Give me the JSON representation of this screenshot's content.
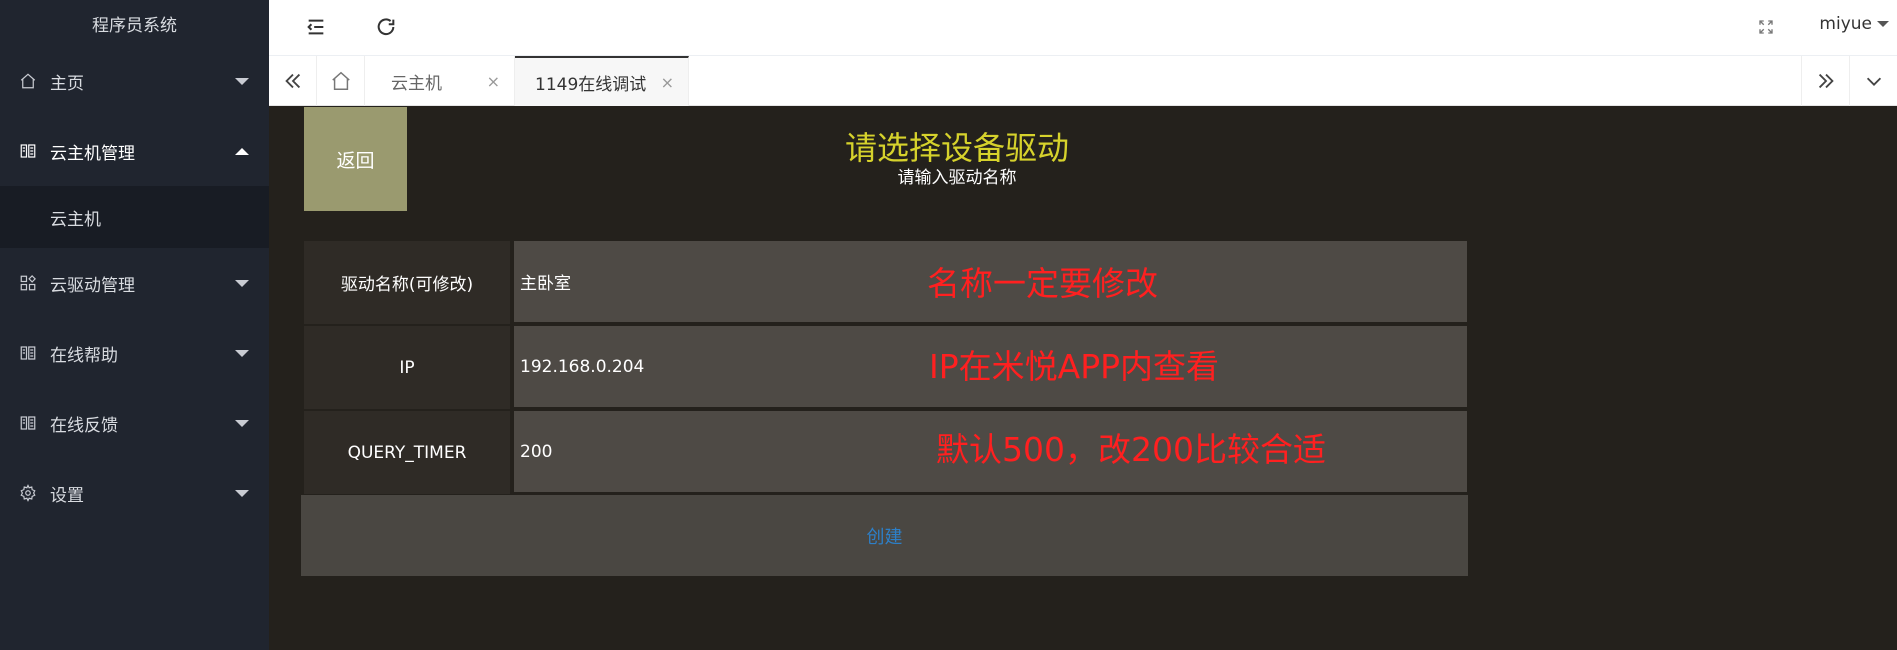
{
  "sidebar": {
    "brand": "程序员系统",
    "items": [
      {
        "label": "主页",
        "icon": "home-icon"
      },
      {
        "label": "云主机管理",
        "icon": "cloud-host-icon"
      },
      {
        "label": "云驱动管理",
        "icon": "apps-icon"
      },
      {
        "label": "在线帮助",
        "icon": "help-icon"
      },
      {
        "label": "在线反馈",
        "icon": "feedback-icon"
      },
      {
        "label": "设置",
        "icon": "gear-icon"
      }
    ],
    "sub_item": "云主机"
  },
  "header": {
    "user": "miyue"
  },
  "tabs": [
    {
      "label": "云主机",
      "close": "×"
    },
    {
      "label": "1149在线调试",
      "close": "×"
    }
  ],
  "content": {
    "back_label": "返回",
    "title": "请选择设备驱动",
    "subtitle": "请输入驱动名称",
    "rows": [
      {
        "label": "驱动名称(可修改)",
        "value": "主卧室",
        "note": "名称一定要修改"
      },
      {
        "label": "IP",
        "value": "192.168.0.204",
        "note": "IP在米悦APP内查看"
      },
      {
        "label": "QUERY_TIMER",
        "value": "200",
        "note": "默认500，改200比较合适"
      }
    ],
    "create_label": "创建"
  },
  "colors": {
    "sidebar_bg": "#20252f",
    "content_bg": "#24211c",
    "title": "#d6d22c",
    "annotation": "#ff2020",
    "back_button": "#9a9a6f",
    "create_link": "#2d7fc7"
  }
}
